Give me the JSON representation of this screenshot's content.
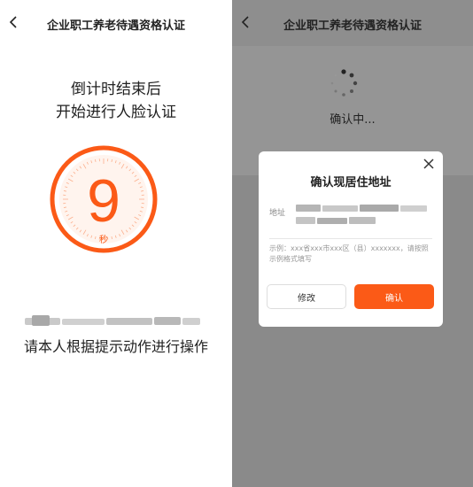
{
  "colors": {
    "accent": "#fb5a17",
    "overlay": "#8a8a8a"
  },
  "left": {
    "title": "企业职工养老待遇资格认证",
    "prompt_line1": "倒计时结束后",
    "prompt_line2": "开始进行人脸认证",
    "countdown": {
      "value": "9",
      "unit": "秒"
    },
    "instruction": "请本人根据提示动作进行操作"
  },
  "right": {
    "title": "企业职工养老待遇资格认证",
    "loading_text": "确认中...",
    "dialog": {
      "title": "确认现居住地址",
      "address_label": "地址",
      "hint": "示例：xxx省xxx市xxx区（县）xxxxxxx，请按照示例格式填写",
      "modify_label": "修改",
      "confirm_label": "确认"
    }
  },
  "icons": [
    "back-icon",
    "close-icon",
    "spinner-icon"
  ]
}
